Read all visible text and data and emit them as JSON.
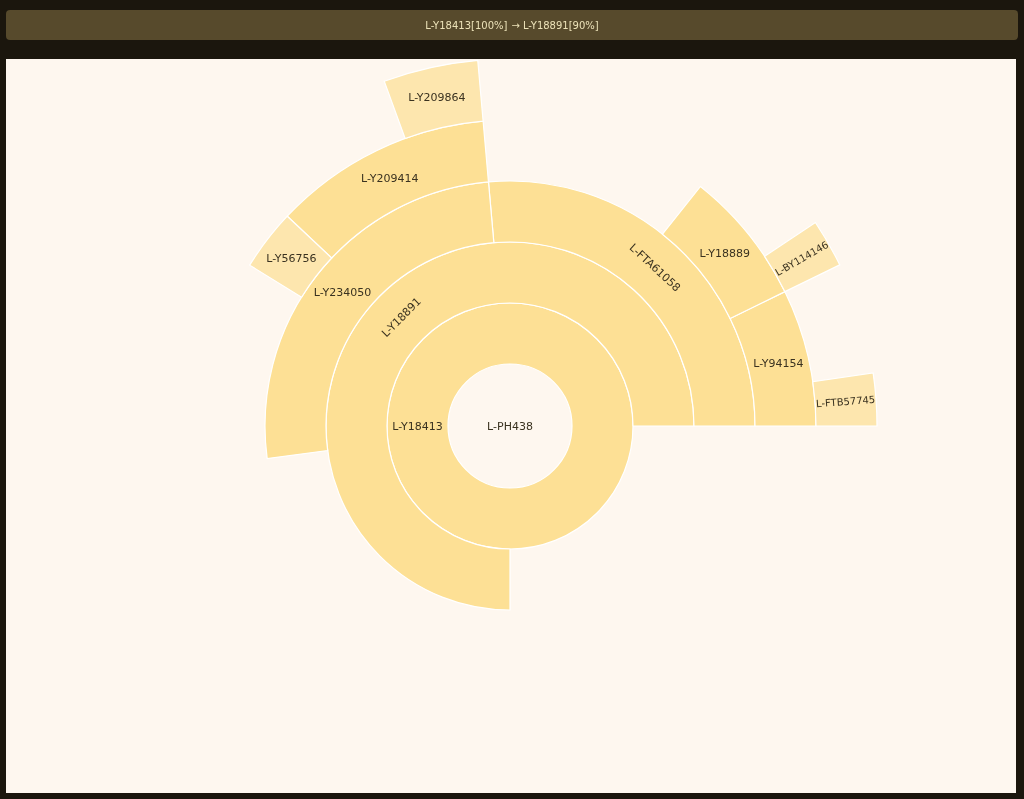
{
  "breadcrumb": [
    {
      "label": "L-Y18413[100%]"
    },
    {
      "label": "→ L-Y18891[90%]"
    }
  ],
  "sunburst": {
    "label": "L-PH438",
    "children": [
      {
        "label": "L-Y18413",
        "kind": "horizontal",
        "children": [
          {
            "label": "L-Y18891",
            "kind": "tangential",
            "children": [
              {
                "label": "L-FTA61058",
                "kind": "tangential",
                "children": [
                  {
                    "label": "L-Y94154",
                    "kind": "horizontal",
                    "children": [
                      {
                        "label": "L-FTB57745",
                        "kind": "radial"
                      }
                    ]
                  },
                  {
                    "label": "L-Y18889",
                    "kind": "horizontal",
                    "children": [
                      {
                        "label": "L-BY114146",
                        "kind": "radial"
                      }
                    ]
                  }
                ]
              },
              {
                "label": "L-Y234050",
                "kind": "horizontal",
                "children": [
                  {
                    "label": "L-Y209414",
                    "kind": "horizontal",
                    "children": [
                      {
                        "label": "L-Y209864",
                        "kind": "horizontal"
                      }
                    ]
                  },
                  {
                    "label": "L-Y56756",
                    "kind": "horizontal"
                  }
                ]
              }
            ]
          }
        ]
      }
    ]
  }
}
